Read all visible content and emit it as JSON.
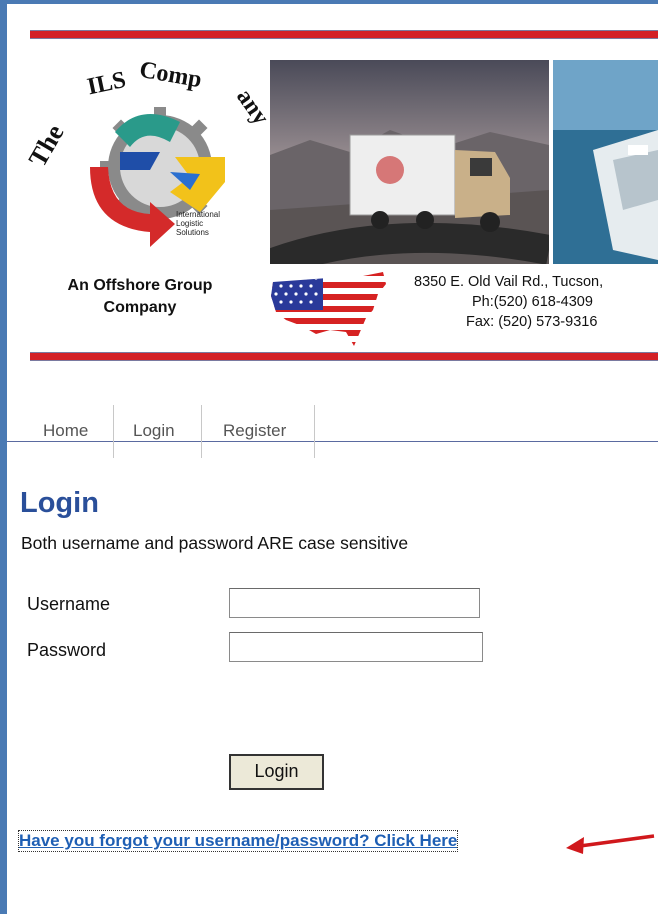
{
  "header": {
    "logo_text": "The ILS Company",
    "logo_subtext": [
      "International",
      "Logistic",
      "Solutions"
    ],
    "tagline_line1": "An Offshore Group",
    "tagline_line2": "Company",
    "address_line1": "8350 E. Old Vail Rd.,  Tucson,",
    "address_line2": "Ph:(520) 618-4309",
    "address_line3": "Fax: (520) 573-9316"
  },
  "nav": {
    "items": [
      {
        "label": "Home"
      },
      {
        "label": "Login"
      },
      {
        "label": "Register"
      }
    ]
  },
  "login": {
    "title": "Login",
    "description": "Both username and password ARE case sensitive",
    "username_label": "Username",
    "username_value": "",
    "password_label": "Password",
    "password_value": "",
    "button_label": "Login",
    "forgot_link": "Have you forgot your username/password? Click Here"
  },
  "colors": {
    "frame": "#4a7ab4",
    "red_bar": "#d32027",
    "title_blue": "#2a4f9a",
    "link_blue": "#1f5fb4",
    "annotation_arrow": "#d0181c"
  }
}
